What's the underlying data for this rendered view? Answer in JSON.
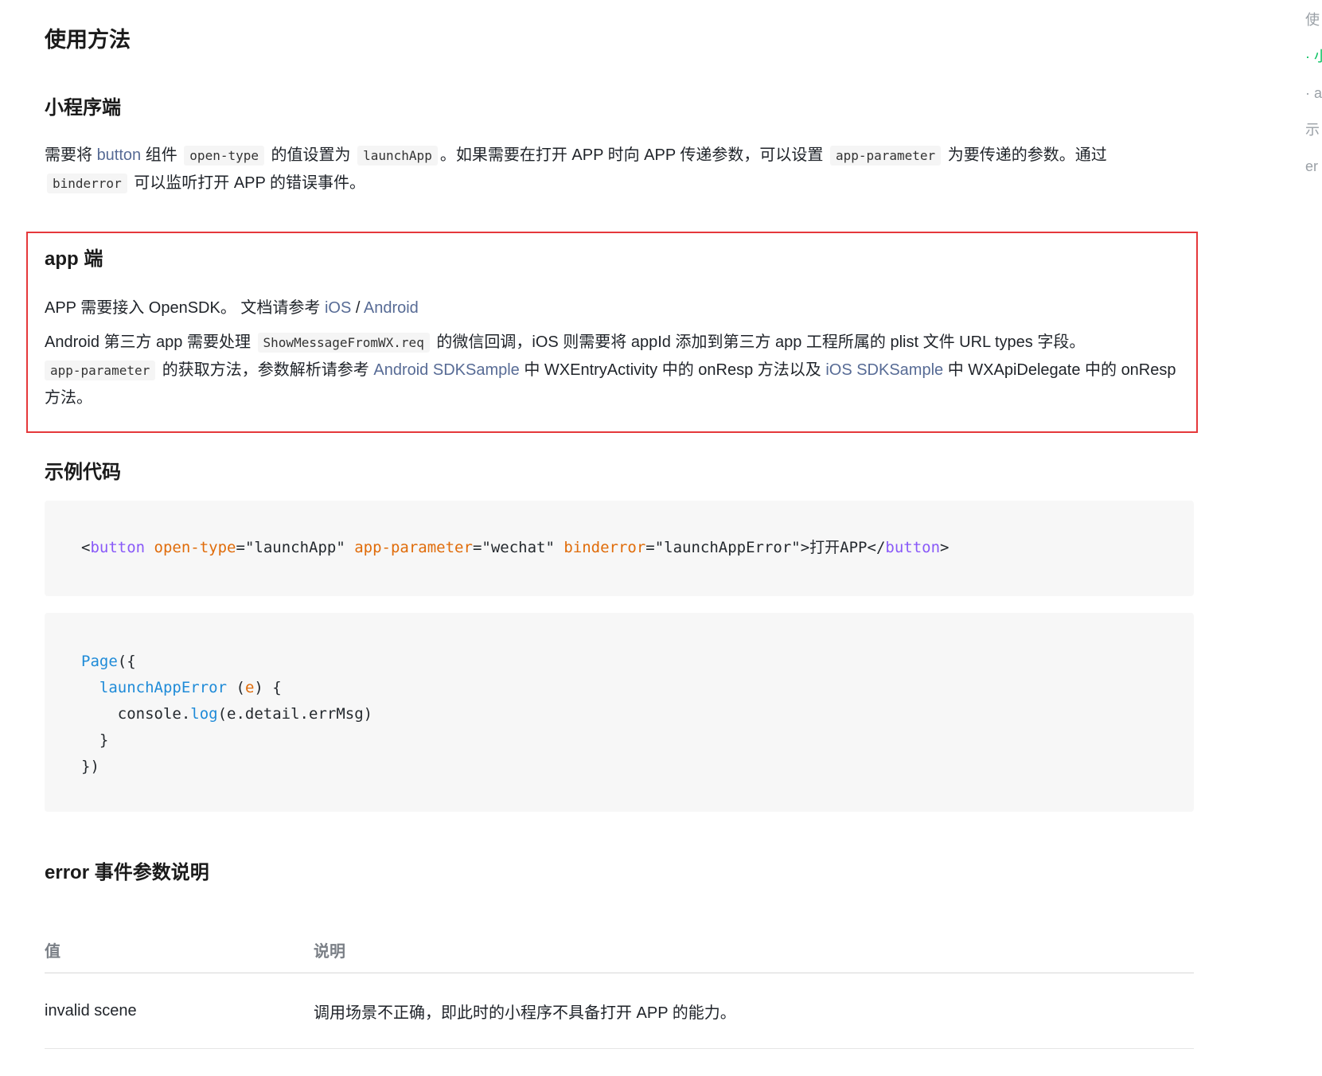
{
  "section_title": "使用方法",
  "miniprogram": {
    "title": "小程序端",
    "t1": "需要将 ",
    "button_link": "button",
    "t2": " 组件 ",
    "code_open_type": "open-type",
    "t3": " 的值设置为 ",
    "code_launchapp": "launchApp",
    "t4": "。如果需要在打开 APP 时向 APP 传递参数，可以设置 ",
    "code_app_parameter": "app-parameter",
    "t5": " 为要传递的参数。通过 ",
    "code_binderror": "binderror",
    "t6": " 可以监听打开 APP 的错误事件。"
  },
  "app": {
    "title": "app 端",
    "p1_t1": "APP 需要接入 OpenSDK。 文档请参考 ",
    "ios_link": "iOS",
    "slash": " / ",
    "android_link": "Android",
    "p2_t1": "Android 第三方 app 需要处理 ",
    "code_show": "ShowMessageFromWX.req",
    "p2_t2": " 的微信回调，iOS 则需要将 appId 添加到第三方 app 工程所属的 plist 文件 URL types 字段。",
    "code_app_parameter": "app-parameter",
    "p2_t3": " 的获取方法，参数解析请参考 ",
    "android_sample": "Android SDKSample",
    "p2_t4": " 中 WXEntryActivity 中的 onResp 方法以及 ",
    "ios_sample": "iOS SDKSample",
    "p2_t5": " 中 WXApiDelegate 中的 onResp 方法。"
  },
  "example": {
    "title": "示例代码",
    "code1": {
      "lt": "<",
      "tag": "button",
      "attr1": "open-type",
      "val1": "=\"launchApp\" ",
      "attr2": "app-parameter",
      "val2": "=\"wechat\" ",
      "attr3": "binderror",
      "val3": "=\"launchAppError\">打开APP</",
      "close_tag": "button",
      "gt": ">"
    },
    "code2": {
      "page_fn": "Page",
      "page_rest": "({",
      "indent2": "  ",
      "method": "launchAppError",
      "paren_open": " (",
      "param": "e",
      "paren_close": ") {",
      "indent4": "    ",
      "console": "console.",
      "log_fn": "log",
      "log_args": "(e.detail.errMsg)",
      "close_method": "  }",
      "close_page": "})"
    }
  },
  "error_section": {
    "title": "error 事件参数说明",
    "headers": [
      "值",
      "说明"
    ],
    "rows": [
      [
        "invalid scene",
        "调用场景不正确，即此时的小程序不具备打开 APP 的能力。"
      ]
    ]
  },
  "toc": [
    "使",
    "· 小",
    "· a",
    "示",
    "er"
  ],
  "colors": {
    "link": "#576b95",
    "highlight_border": "#e5383b",
    "toc_active": "#07c160"
  }
}
